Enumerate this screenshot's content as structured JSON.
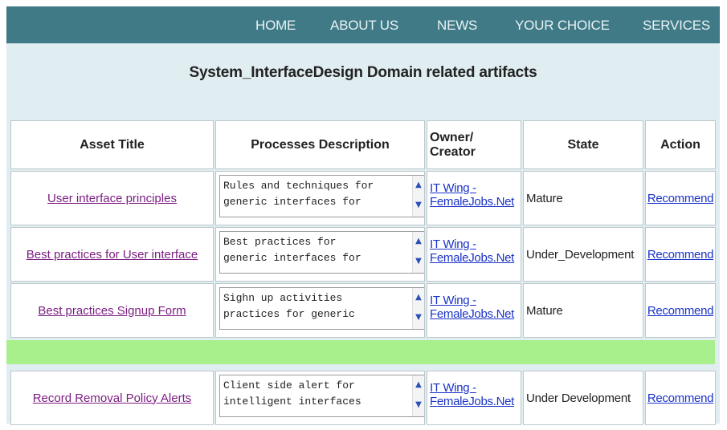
{
  "nav": {
    "items": [
      {
        "label": "HOME"
      },
      {
        "label": "ABOUT US"
      },
      {
        "label": "NEWS"
      },
      {
        "label": "YOUR CHOICE"
      },
      {
        "label": "SERVICES"
      }
    ]
  },
  "page": {
    "title": "System_InterfaceDesign Domain related artifacts"
  },
  "table": {
    "headers": {
      "asset_title": "Asset Title",
      "processes_description": "Processes Description",
      "owner_line1": "Owner/",
      "owner_line2": "Creator",
      "state": "State",
      "action": "Action"
    },
    "rows": [
      {
        "title": "User interface principles",
        "description": "Rules and techniques for\ngeneric interfaces for",
        "owner_line1": "IT Wing -",
        "owner_line2": "FemaleJobs.Net",
        "state": "Mature",
        "action": "Recommend"
      },
      {
        "title": "Best practices for User interface",
        "description": "Best practices for\ngeneric interfaces for",
        "owner_line1": "IT Wing -",
        "owner_line2": "FemaleJobs.Net",
        "state": "Under_Development",
        "action": "Recommend"
      },
      {
        "title": "Best practices Signup Form",
        "description": "Sighn up activities\npractices for generic",
        "owner_line1": "IT Wing -",
        "owner_line2": "FemaleJobs.Net",
        "state": "Mature",
        "action": "Recommend"
      },
      {
        "title": "Record Removal Policy Alerts",
        "description": "Client side alert for\nintelligent interfaces",
        "owner_line1": "IT Wing -",
        "owner_line2": "FemaleJobs.Net",
        "state": "Under Development",
        "action": "Recommend"
      }
    ]
  },
  "icons": {
    "scroll_up": "▲",
    "scroll_down": "▼"
  },
  "colors": {
    "navbar": "#3f7a86",
    "page_background": "#e0edf1",
    "separator_row": "#a8f08c",
    "visited_link": "#7b1e82",
    "link": "#1a33c8"
  }
}
